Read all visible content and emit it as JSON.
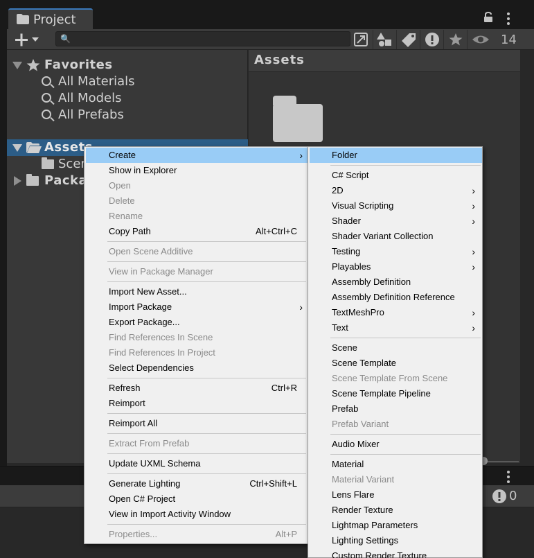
{
  "window": {
    "tab_label": "Project",
    "visible_count": "14"
  },
  "search": {
    "placeholder": ""
  },
  "tree": {
    "favorites_label": "Favorites",
    "favorites": [
      "All Materials",
      "All Models",
      "All Prefabs"
    ],
    "assets_label": "Assets",
    "scenes_partial": "Scen",
    "packages_partial": "Packa"
  },
  "assets_panel": {
    "title": "Assets"
  },
  "console": {
    "error_count": "0"
  },
  "context_menu": [
    {
      "label": "Create",
      "submenu": true,
      "selected": true
    },
    {
      "label": "Show in Explorer"
    },
    {
      "label": "Open",
      "disabled": true
    },
    {
      "label": "Delete",
      "disabled": true
    },
    {
      "label": "Rename",
      "disabled": true
    },
    {
      "label": "Copy Path",
      "shortcut": "Alt+Ctrl+C"
    },
    {
      "label": "Open Scene Additive",
      "disabled": true
    },
    {
      "label": "View in Package Manager",
      "disabled": true
    },
    {
      "label": "Import New Asset..."
    },
    {
      "label": "Import Package",
      "submenu": true
    },
    {
      "label": "Export Package..."
    },
    {
      "label": "Find References In Scene",
      "disabled": true
    },
    {
      "label": "Find References In Project",
      "disabled": true
    },
    {
      "label": "Select Dependencies"
    },
    {
      "label": "Refresh",
      "shortcut": "Ctrl+R"
    },
    {
      "label": "Reimport"
    },
    {
      "label": "Reimport All"
    },
    {
      "label": "Extract From Prefab",
      "disabled": true
    },
    {
      "label": "Update UXML Schema"
    },
    {
      "label": "Generate Lighting",
      "shortcut": "Ctrl+Shift+L"
    },
    {
      "label": "Open C# Project"
    },
    {
      "label": "View in Import Activity Window"
    },
    {
      "label": "Properties...",
      "shortcut": "Alt+P",
      "disabled": true
    }
  ],
  "create_submenu": [
    {
      "label": "Folder",
      "selected": true
    },
    {
      "label": "C# Script"
    },
    {
      "label": "2D",
      "submenu": true
    },
    {
      "label": "Visual Scripting",
      "submenu": true
    },
    {
      "label": "Shader",
      "submenu": true
    },
    {
      "label": "Shader Variant Collection"
    },
    {
      "label": "Testing",
      "submenu": true
    },
    {
      "label": "Playables",
      "submenu": true
    },
    {
      "label": "Assembly Definition"
    },
    {
      "label": "Assembly Definition Reference"
    },
    {
      "label": "TextMeshPro",
      "submenu": true
    },
    {
      "label": "Text",
      "submenu": true
    },
    {
      "label": "Scene"
    },
    {
      "label": "Scene Template"
    },
    {
      "label": "Scene Template From Scene",
      "disabled": true
    },
    {
      "label": "Scene Template Pipeline"
    },
    {
      "label": "Prefab"
    },
    {
      "label": "Prefab Variant",
      "disabled": true
    },
    {
      "label": "Audio Mixer"
    },
    {
      "label": "Material"
    },
    {
      "label": "Material Variant",
      "disabled": true
    },
    {
      "label": "Lens Flare"
    },
    {
      "label": "Render Texture"
    },
    {
      "label": "Lightmap Parameters"
    },
    {
      "label": "Lighting Settings"
    },
    {
      "label": "Custom Render Texture"
    }
  ]
}
